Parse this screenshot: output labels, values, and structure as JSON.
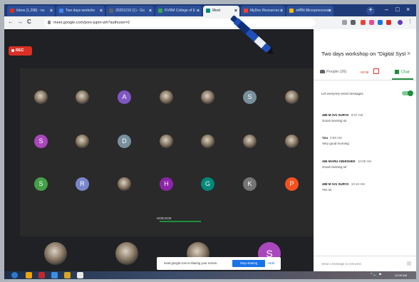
{
  "browser": {
    "tabs": [
      {
        "label": "Inbox (1,298) - nu",
        "icon_color": "#d93025"
      },
      {
        "label": "Two days worksho",
        "icon_color": "#4285f4"
      },
      {
        "label": "20201210 (1) - Go",
        "icon_color": "#5f6368"
      },
      {
        "label": "KVRM College of E",
        "icon_color": "#34a853"
      },
      {
        "label": "Meet",
        "icon_color": "#00897b",
        "active": true
      },
      {
        "label": "MyDev Resources",
        "icon_color": "#ea4335"
      },
      {
        "label": "अरविंद Microprocessor",
        "icon_color": "#fbbc04"
      }
    ],
    "tab_close": "×",
    "new_tab": "+",
    "url": "meet.google.com/jxeo-jupm-wh?authuser=2",
    "nav": {
      "back": "←",
      "forward": "→",
      "reload": "C"
    },
    "window_minimize": "–",
    "window_maximize": "□",
    "window_close": "×"
  },
  "meet": {
    "rec_label": "REC",
    "rows": [
      [
        {
          "type": "photo"
        },
        {
          "type": "photo"
        },
        {
          "type": "letter",
          "letter": "A",
          "color": "#7e57c2"
        },
        {
          "type": "photo"
        },
        {
          "type": "photo"
        },
        {
          "type": "letter",
          "letter": "S",
          "color": "#78909c"
        },
        {
          "type": "photo"
        }
      ],
      [
        {
          "type": "letter",
          "letter": "S",
          "color": "#ab47bc"
        },
        {
          "type": "photo"
        },
        {
          "type": "letter",
          "letter": "D",
          "color": "#78909c"
        },
        {
          "type": "photo"
        },
        {
          "type": "photo"
        },
        {
          "type": "photo"
        },
        {
          "type": "photo"
        }
      ],
      [
        {
          "type": "letter",
          "letter": "S",
          "color": "#43a047"
        },
        {
          "type": "letter",
          "letter": "R",
          "color": "#7986cb"
        },
        {
          "type": "photo"
        },
        {
          "type": "letter",
          "letter": "H",
          "color": "#8e24aa"
        },
        {
          "type": "letter",
          "letter": "G",
          "color": "#00897b"
        },
        {
          "type": "letter",
          "letter": "K",
          "color": "#757575"
        },
        {
          "type": "letter",
          "letter": "P",
          "color": "#f4511e"
        }
      ]
    ],
    "hod_label": "HOD ECE",
    "bottom_tiles": [
      {
        "type": "photo"
      },
      {
        "type": "photo"
      },
      {
        "type": "photo"
      },
      {
        "type": "letter",
        "letter": "S",
        "color": "#ab47bc"
      }
    ],
    "share_text": "meet.google.com is sharing your screen.",
    "stop_sharing": "Stop sharing",
    "hide": "Hide"
  },
  "panel": {
    "title": "Two days workshop on \"Digital Syst...",
    "close": "×",
    "people_tab": "People (26)",
    "timer": "00:08",
    "chat_tab": "Chat",
    "let_everyone": "Let everyone send messages",
    "messages": [
      {
        "sender": "488 M SAI SURYA",
        "time": "9:57 AM",
        "text": "Good morning sir"
      },
      {
        "sender": "You",
        "time": "9:59 AM",
        "text": "Very good morning"
      },
      {
        "sender": "496 MARU ABHISHEK",
        "time": "10:09 AM",
        "text": "Good morning sir"
      },
      {
        "sender": "488 M SAI SURYA",
        "time": "10:10 AM",
        "text": "Yes sir"
      }
    ],
    "send_placeholder": "Send a message to everyone"
  },
  "taskbar": {
    "icons": [
      "#2b79d0",
      "#f0a30a",
      "#c1272d",
      "#3a8ee6",
      "#d9a520",
      "#e8e8e8"
    ],
    "clock": "10:09 AM",
    "tray": "^ 🔈 ⚑"
  }
}
